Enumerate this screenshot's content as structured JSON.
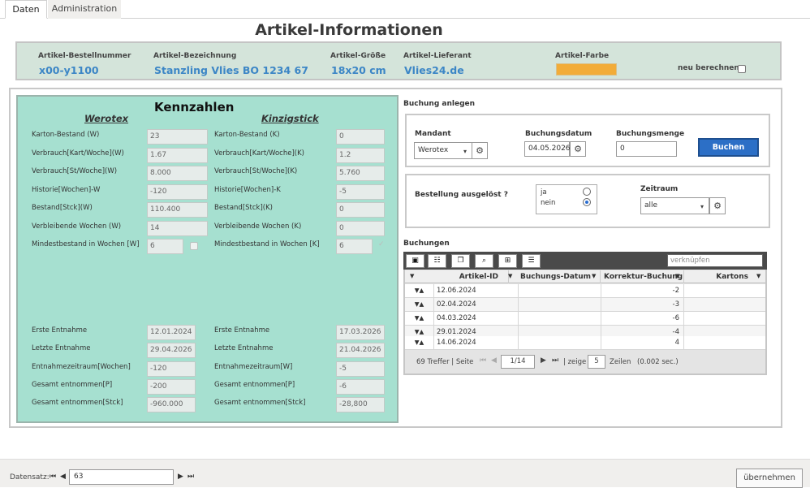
{
  "tabs": [
    {
      "label": "Daten"
    },
    {
      "label": "Administration"
    }
  ],
  "page_title": "Artikel-Informationen",
  "header": {
    "bestellnummer_label": "Artikel-Bestellnummer",
    "bestellnummer": "x00-y1100",
    "bezeichnung_label": "Artikel-Bezeichnung",
    "bezeichnung": "Stanzling Vlies BO 1234 67",
    "groesse_label": "Artikel-Größe",
    "groesse": "18x20 cm",
    "lieferant_label": "Artikel-Lieferant",
    "lieferant": "Vlies24.de",
    "farbe_label": "Artikel-Farbe",
    "farbe_color": "#f2ac38",
    "neu_label": "neu berechnen"
  },
  "kennzahlen": {
    "title": "Kennzahlen",
    "col_w": "Werotex",
    "col_k": "Kinzigstick",
    "rows_top": [
      {
        "lw": "Karton-Bestand (W)",
        "vw": "23",
        "lk": "Karton-Bestand (K)",
        "vk": "0"
      },
      {
        "lw": "Verbrauch[Kart/Woche](W)",
        "vw": "1.67",
        "lk": "Verbrauch[Kart/Woche](K)",
        "vk": "1.2"
      },
      {
        "lw": "Verbrauch[St/Woche](W)",
        "vw": "8.000",
        "lk": "Verbrauch[St/Woche](K)",
        "vk": "5.760"
      },
      {
        "lw": "Historie[Wochen]-W",
        "vw": "-120",
        "lk": "Historie[Wochen]-K",
        "vk": "-5"
      },
      {
        "lw": "Bestand[Stck](W)",
        "vw": "110.400",
        "lk": "Bestand[Stck](K)",
        "vk": "0"
      },
      {
        "lw": "Verbleibende Wochen (W)",
        "vw": "14",
        "lk": "Verbleibende Wochen (K)",
        "vk": "0"
      },
      {
        "lw": "Mindestbestand in Wochen [W]",
        "vw": "6",
        "lk": "Mindestbestand in Wochen [K]",
        "vk": "6"
      }
    ],
    "rows_bottom": [
      {
        "lw": "Erste Entnahme",
        "vw": "12.01.2024",
        "lk": "Erste Entnahme",
        "vk": "17.03.2026"
      },
      {
        "lw": "Letzte Entnahme",
        "vw": "29.04.2026",
        "lk": "Letzte Entnahme",
        "vk": "21.04.2026"
      },
      {
        "lw": "Entnahmezeitraum[Wochen]",
        "vw": "-120",
        "lk": "Entnahmezeitraum[W]",
        "vk": "-5"
      },
      {
        "lw": "Gesamt entnommen[P]",
        "vw": "-200",
        "lk": "Gesamt entnommen[P]",
        "vk": "-6"
      },
      {
        "lw": "Gesamt entnommen[Stck]",
        "vw": "-960.000",
        "lk": "Gesamt entnommen[Stck]",
        "vk": "-28,800"
      }
    ]
  },
  "buchung": {
    "section_title": "Buchung anlegen",
    "mandant_label": "Mandant",
    "mandant_value": "Werotex",
    "datum_label": "Buchungsdatum",
    "datum_value": "04.05.2026",
    "menge_label": "Buchungsmenge",
    "menge_value": "0",
    "buchen_label": "Buchen",
    "bestellung_label": "Bestellung ausgelöst ?",
    "ja_label": "ja",
    "nein_label": "nein",
    "zeitraum_label": "Zeitraum",
    "zeitraum_value": "alle"
  },
  "buchungen": {
    "section_title": "Buchungen",
    "search_placeholder": "verknüpfen",
    "columns": [
      "Artikel-ID",
      "Buchungs-Datum",
      "Korrektur-Buchung",
      "Kartons"
    ],
    "rows": [
      {
        "date": "12.06.2024",
        "korrektur": "-2"
      },
      {
        "date": "02.04.2024",
        "korrektur": "-3"
      },
      {
        "date": "04.03.2024",
        "korrektur": "-6"
      },
      {
        "date": "29.01.2024",
        "korrektur": "-4"
      },
      {
        "date": "14.06.2024",
        "korrektur": "4"
      }
    ],
    "footer": {
      "treffer": "69 Treffer | Seite",
      "page": "1/14",
      "zeige": "| zeige",
      "zeige_value": "5",
      "zeilen": "Zeilen",
      "time": "(0.002 sec.)"
    }
  },
  "bottom": {
    "datensatz_label": "Datensatz:",
    "datensatz_value": "63",
    "uebernehmen_label": "übernehmen"
  }
}
